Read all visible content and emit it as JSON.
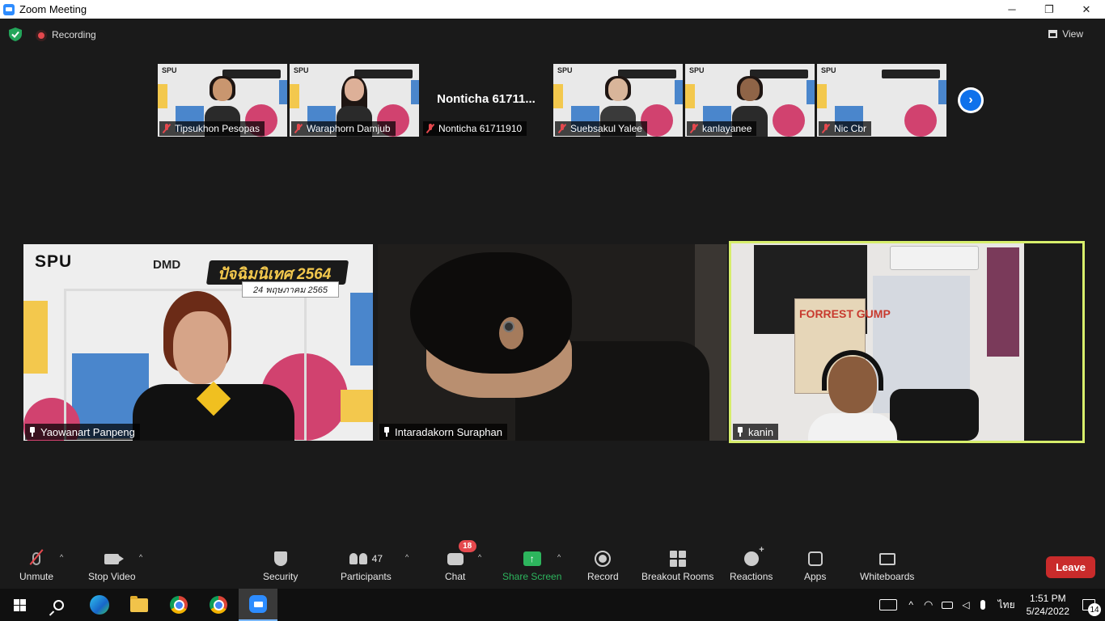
{
  "window": {
    "title": "Zoom Meeting",
    "controls": [
      "─",
      "❐",
      "✕"
    ]
  },
  "status": {
    "recording_label": "Recording",
    "view_label": "View"
  },
  "thumbnails": [
    {
      "name": "Tipsukhon Pesopas",
      "muted": true
    },
    {
      "name": "Waraphorn Damjub",
      "muted": true
    },
    {
      "name": "Nonticha 61711910",
      "display": "Nonticha 61711...",
      "muted": true
    },
    {
      "name": "Suebsakul Yalee",
      "muted": true
    },
    {
      "name": "kanlayanee",
      "muted": true
    },
    {
      "name": "Nic Cbr",
      "muted": true
    }
  ],
  "next_page_glyph": "›",
  "main_tiles": [
    {
      "name": "Yaowanart Panpeng",
      "pinned": true
    },
    {
      "name": "Intaradakorn Suraphan",
      "pinned": true
    },
    {
      "name": "kanin",
      "pinned": true,
      "active_speaker": true
    }
  ],
  "slide": {
    "logo": "SPU",
    "brand": "DMD",
    "title": "ปัจฉิมนิเทศ 2564",
    "date": "24 พฤษภาคม 2565",
    "thumb_logo": "SPU"
  },
  "poster_text": "FORREST GUMP",
  "toolbar": {
    "unmute": "Unmute",
    "stop_video": "Stop Video",
    "security": "Security",
    "participants": "Participants",
    "participants_count": "47",
    "chat": "Chat",
    "chat_badge": "18",
    "share_screen": "Share Screen",
    "record": "Record",
    "breakout_rooms": "Breakout Rooms",
    "reactions": "Reactions",
    "apps": "Apps",
    "whiteboards": "Whiteboards",
    "leave": "Leave",
    "caret": "^"
  },
  "taskbar": {
    "language": "ไทย",
    "time": "1:51 PM",
    "date": "5/24/2022",
    "notifications": "14",
    "tray_chevron": "^"
  },
  "colors": {
    "background": "#1a1a1a",
    "active_speaker_border": "#d7ee6b",
    "leave": "#c92b2b",
    "share_green": "#2db55d",
    "badge_red": "#e5484d"
  }
}
